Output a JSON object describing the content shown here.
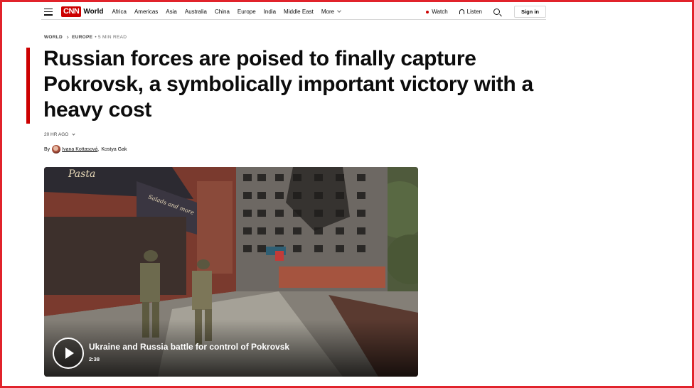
{
  "header": {
    "logo_text": "CNN",
    "section": "World",
    "nav": [
      {
        "label": "Africa"
      },
      {
        "label": "Americas"
      },
      {
        "label": "Asia"
      },
      {
        "label": "Australia"
      },
      {
        "label": "China"
      },
      {
        "label": "Europe"
      },
      {
        "label": "India"
      },
      {
        "label": "Middle East"
      }
    ],
    "more_label": "More",
    "watch_label": "Watch",
    "listen_label": "Listen",
    "signin_label": "Sign in",
    "icons": [
      "hamburger-menu-icon",
      "chevron-down-icon",
      "live-dot-icon",
      "headphones-icon",
      "search-icon"
    ]
  },
  "breadcrumb": {
    "items": [
      "WORLD",
      "EUROPE"
    ],
    "read_time": "• 5 MIN READ"
  },
  "article": {
    "headline": "Russian forces are poised to finally capture Pokrovsk, a symbolically important victory with a heavy cost",
    "timestamp": "20 HR AGO",
    "byline_prefix": "By",
    "author_1": "Ivana Kottasová",
    "author_separator": ",",
    "author_2": "Kostya Gak"
  },
  "video": {
    "title": "Ukraine and Russia battle for control of Pokrovsk",
    "duration": "2:38",
    "sign_text": "Pasta",
    "sign_text_2": "Salads and more"
  },
  "colors": {
    "brand_red": "#cc0000",
    "frame_red": "#e1232b",
    "text": "#0c0c0c"
  }
}
